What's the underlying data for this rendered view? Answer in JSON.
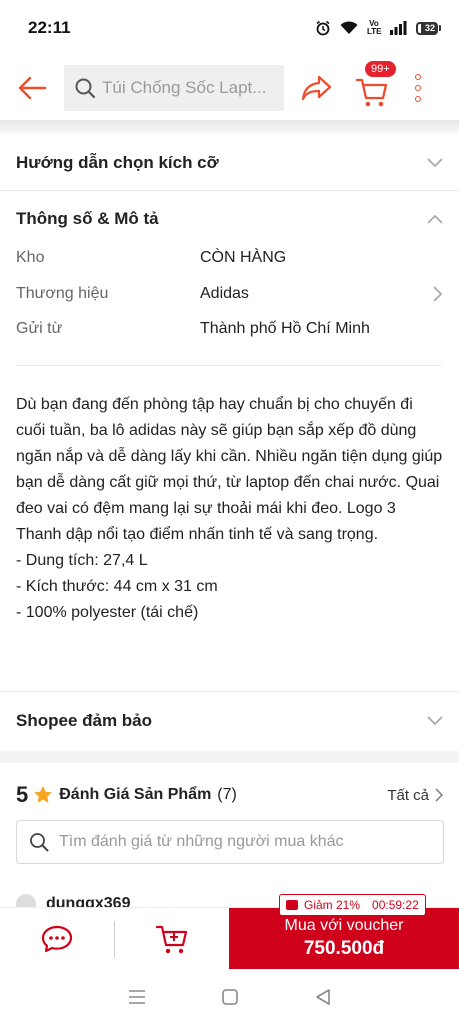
{
  "status_bar": {
    "time": "22:11",
    "network_label": "Vo LTE",
    "battery": "32"
  },
  "header": {
    "search_placeholder": "Túi Chống Sốc Lapt...",
    "cart_badge": "99+"
  },
  "sections": {
    "size_guide": "Hướng dẫn chọn kích cỡ",
    "specs_title": "Thông số & Mô tả",
    "guarantee": "Shopee đảm bảo"
  },
  "specs": [
    {
      "label": "Kho",
      "value": "CÒN HÀNG"
    },
    {
      "label": "Thương hiệu",
      "value": "Adidas"
    },
    {
      "label": "Gửi từ",
      "value": "Thành phố Hồ Chí Minh"
    }
  ],
  "description": {
    "paragraph": "Dù bạn đang đến phòng tập hay chuẩn bị cho chuyến đi cuối tuần, ba lô adidas này sẽ giúp bạn sắp xếp đồ dùng ngăn nắp và dễ dàng lấy khi cần. Nhiều ngăn tiện dụng giúp bạn dễ dàng cất giữ mọi thứ, từ laptop đến chai nước. Quai đeo vai có đệm mang lại sự thoải mái khi đeo. Logo 3 Thanh dập nổi tạo điểm nhấn tinh tế và sang trọng.",
    "bullets": [
      "- Dung tích: 27,4 L",
      "- Kích thước: 44 cm x 31 cm",
      "- 100% polyester (tái chế)"
    ]
  },
  "ratings": {
    "score": "5",
    "label": "Đánh Giá Sản Phẩm",
    "count": "(7)",
    "see_all": "Tất cả",
    "search_placeholder": "Tìm đánh giá từ những người mua khác",
    "first_reviewer": "dungqx369"
  },
  "bottom_bar": {
    "voucher_discount": "Giảm 21%",
    "voucher_timer": "00:59:22",
    "buy_label": "Mua với voucher",
    "buy_price": "750.500đ"
  },
  "colors": {
    "brand": "#ee4d2d",
    "buy_button": "#d0011b",
    "star": "#f5a623"
  }
}
